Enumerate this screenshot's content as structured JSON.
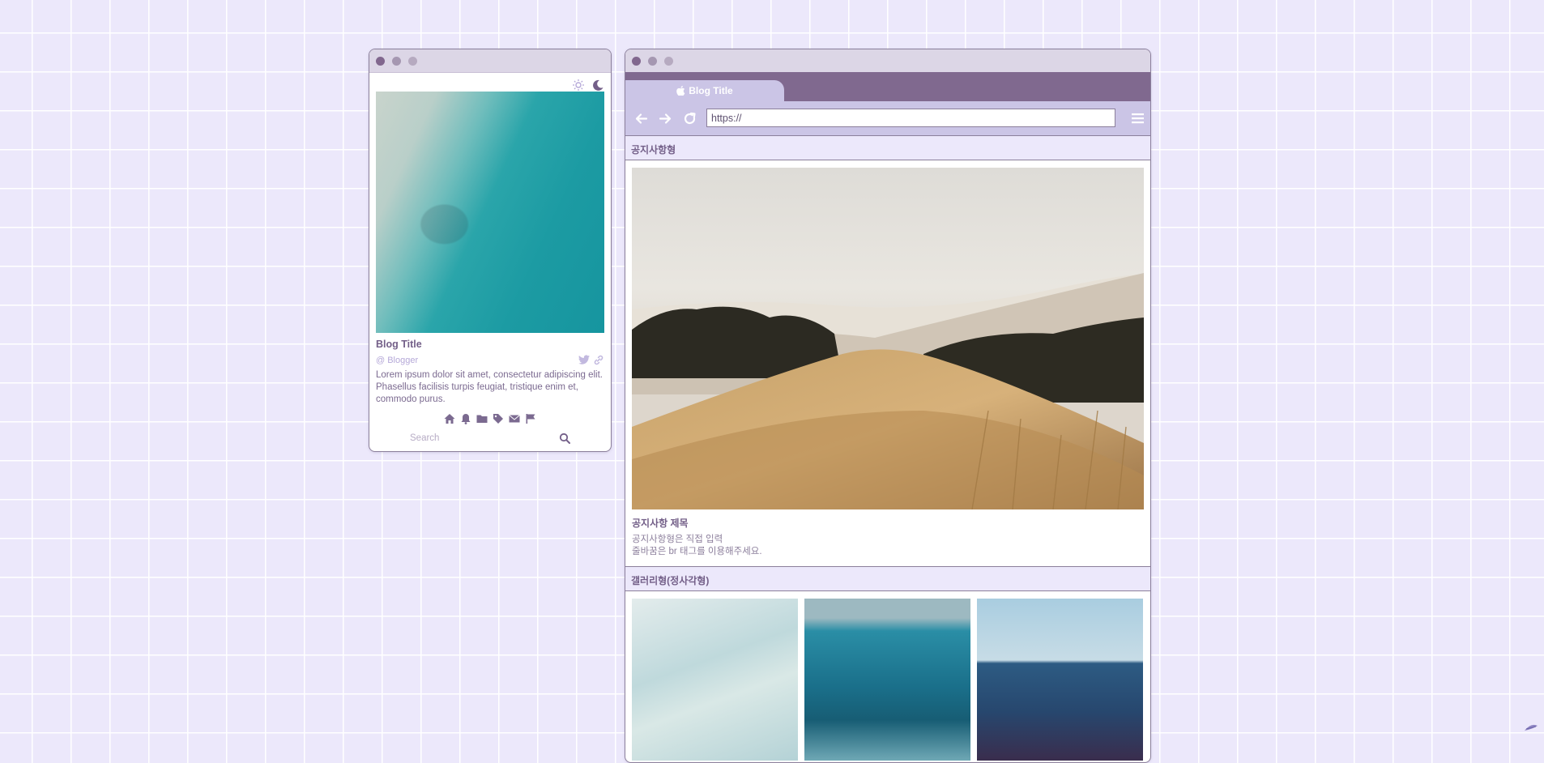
{
  "profile": {
    "title": "Blog Title",
    "username": "@ Blogger",
    "description": "Lorem ipsum dolor sit amet, consectetur adipiscing elit. Phasellus facilisis turpis feugiat, tristique enim et, commodo purus.",
    "search_placeholder": "Search",
    "theme_icons": [
      "sun-icon",
      "moon-icon"
    ],
    "social_icons": [
      "twitter-icon",
      "link-icon"
    ],
    "nav_icons": [
      "home-icon",
      "bell-icon",
      "folder-icon",
      "tag-icon",
      "mail-icon",
      "flag-icon"
    ]
  },
  "browser": {
    "tab_title": "Blog Title",
    "url_value": "https://",
    "nav_icons": [
      "back-arrow-icon",
      "forward-arrow-icon",
      "reload-icon",
      "menu-icon"
    ]
  },
  "notice": {
    "header": "공지사항형",
    "title": "공지사항 제목",
    "body": "공지사항형은 직접 입력\n줄바꿈은 br 태그를 이용해주세요."
  },
  "gallery": {
    "header": "갤러리형(정사각형)",
    "items": [
      "gallery-image-1",
      "gallery-image-2",
      "gallery-image-3"
    ]
  },
  "colors": {
    "background": "#ece8fb",
    "accent": "#80698f",
    "tab": "#cbc5e6",
    "text": "#735f88"
  }
}
